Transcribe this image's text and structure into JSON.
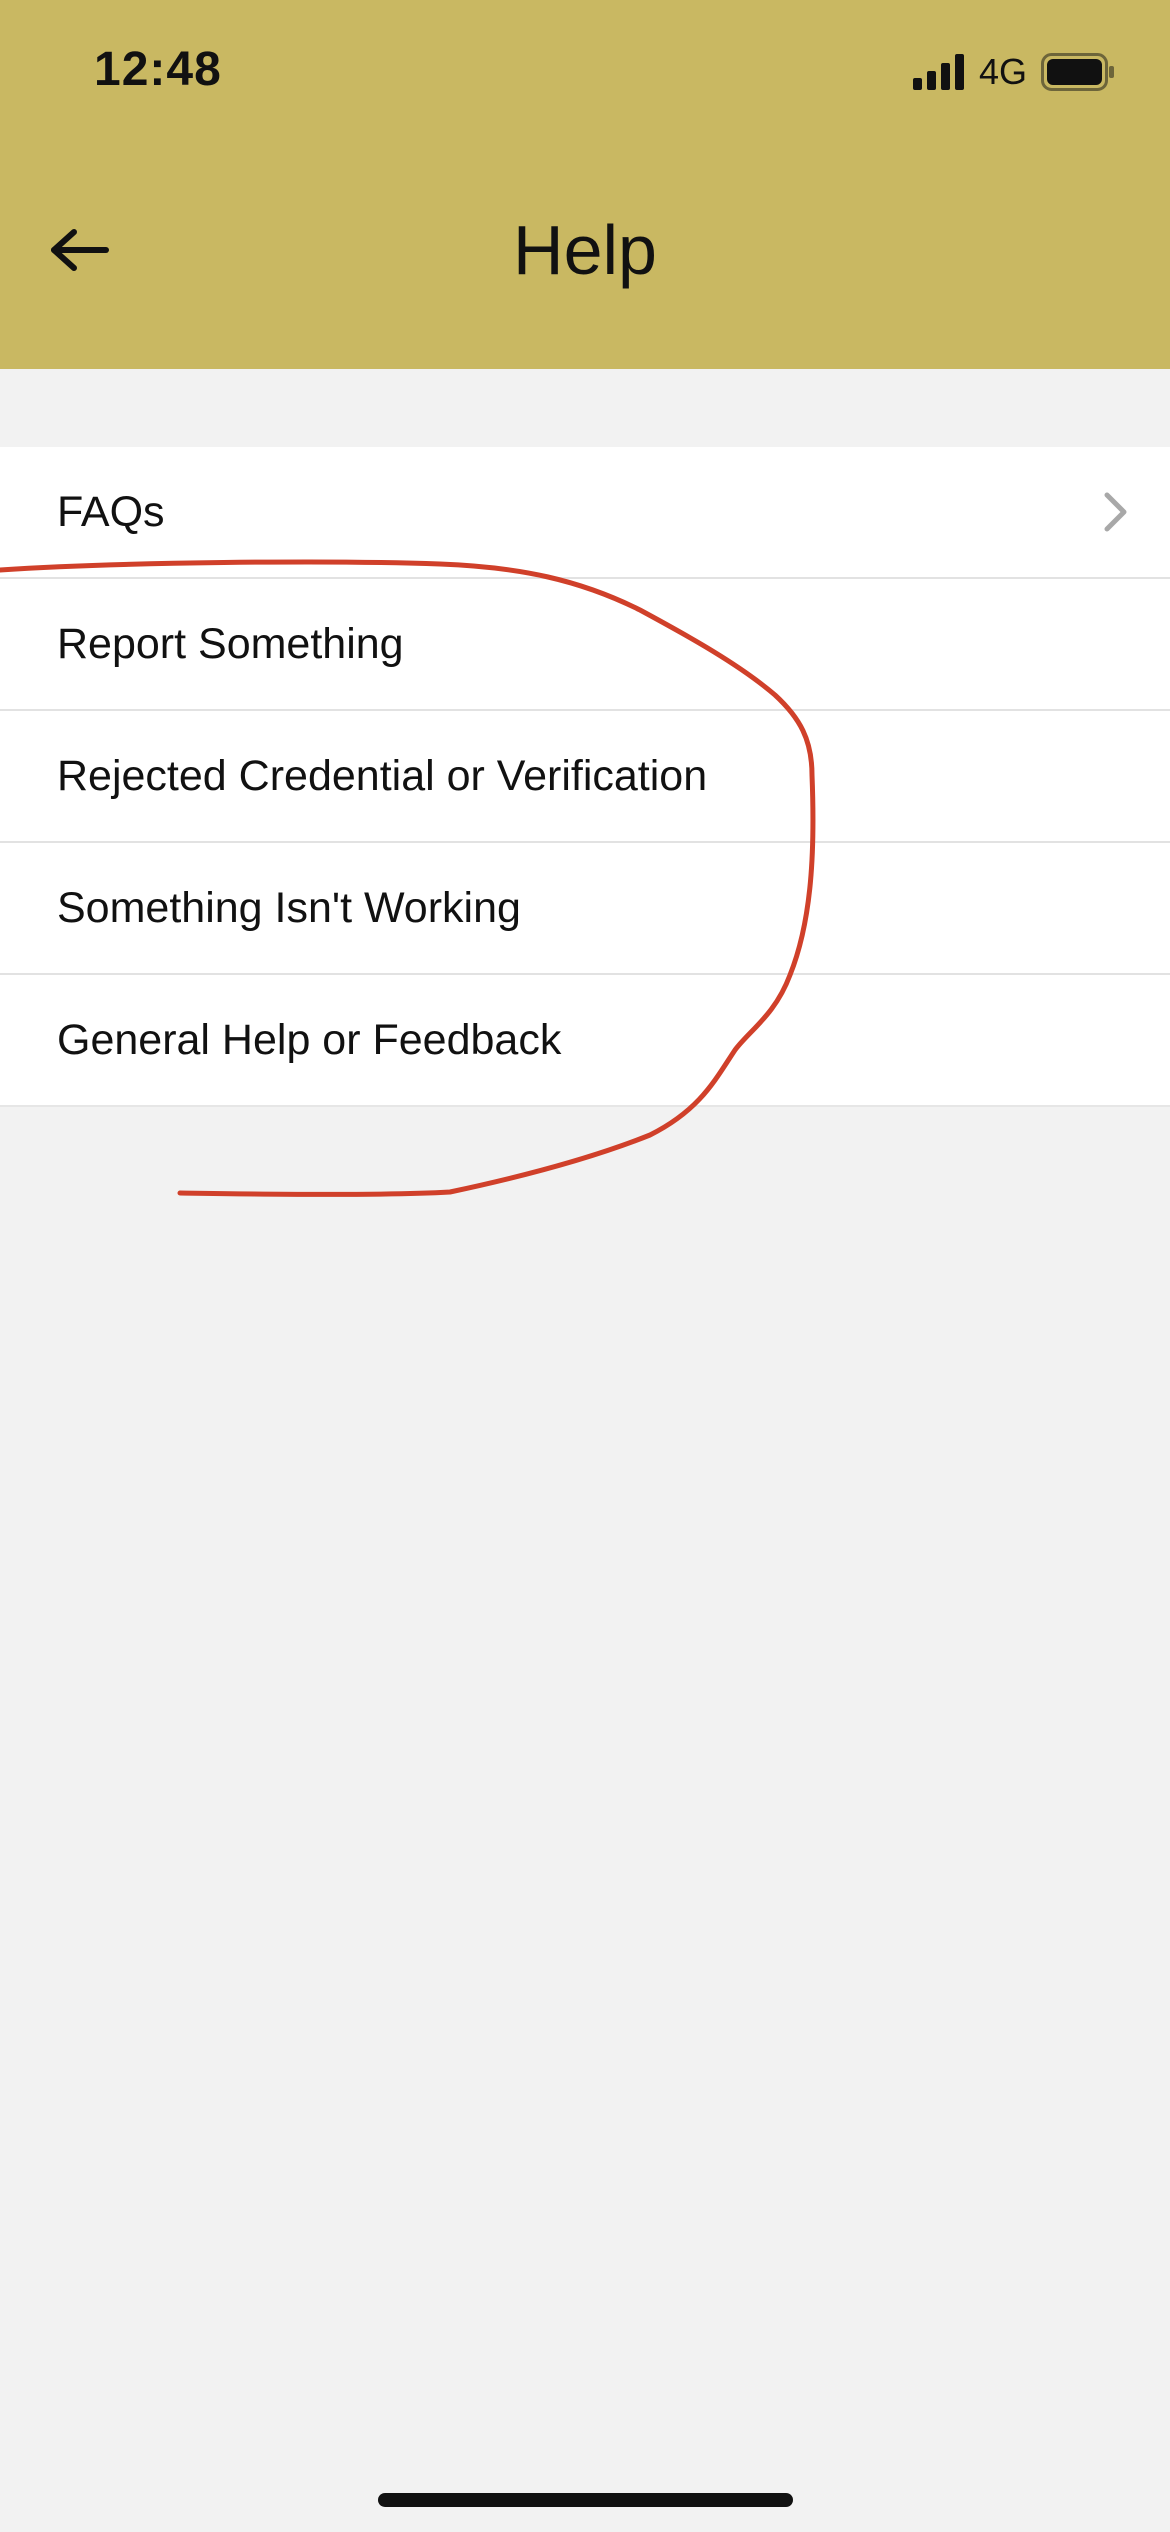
{
  "status_bar": {
    "time": "12:48",
    "network": "4G",
    "signal_icon": "signal-bars-icon",
    "battery_icon": "battery-icon"
  },
  "header": {
    "title": "Help",
    "back_icon": "arrow-left-icon",
    "background_color": "#c9b862"
  },
  "menu": {
    "items": [
      {
        "label": "FAQs",
        "chevron": true
      },
      {
        "label": "Report Something",
        "chevron": false
      },
      {
        "label": "Rejected Credential or Verification",
        "chevron": false
      },
      {
        "label": "Something Isn't Working",
        "chevron": false
      },
      {
        "label": "General Help or Feedback",
        "chevron": false
      }
    ]
  },
  "annotation": {
    "type": "hand-drawn-circle",
    "color": "#d0402a"
  }
}
